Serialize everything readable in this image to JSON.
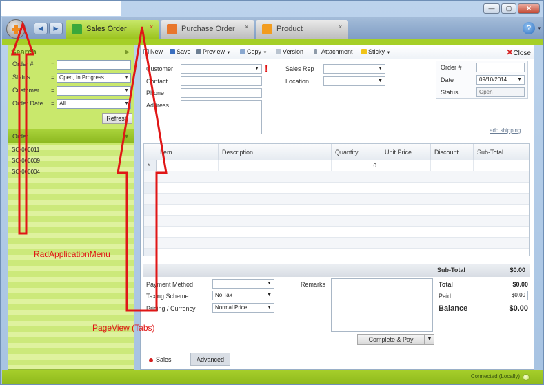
{
  "window": {
    "minimize_glyph": "—",
    "maximize_glyph": "▢",
    "close_glyph": "✕"
  },
  "tabs": [
    {
      "label": "Sales Order",
      "close": "×",
      "icon_color": "#3aa83a"
    },
    {
      "label": "Purchase Order",
      "close": "×",
      "icon_color": "#e8762b"
    },
    {
      "label": "Product",
      "close": "×",
      "icon_color": "#f29c1f"
    }
  ],
  "nav": {
    "back_glyph": "◀",
    "forward_glyph": "▶"
  },
  "help": {
    "glyph": "?",
    "caret": "▾"
  },
  "search": {
    "title": "Search",
    "collapse_glyph": "▶",
    "fields": [
      {
        "label": "Order #",
        "value": ""
      },
      {
        "label": "Status",
        "value": "Open, In Progress"
      },
      {
        "label": "Customer",
        "value": ""
      },
      {
        "label": "Order Date",
        "value": "All"
      }
    ],
    "refresh_label": "Refresh"
  },
  "orders": {
    "header": "Order",
    "sort_glyph": "▼",
    "items": [
      "SO-000011",
      "SO-000009",
      "SO-000004"
    ]
  },
  "toolbar": {
    "new": "New",
    "save": "Save",
    "preview": "Preview",
    "copy": "Copy",
    "version": "Version",
    "attachment": "Attachment",
    "sticky": "Sticky",
    "close": "Close"
  },
  "form": {
    "customer_label": "Customer",
    "contact_label": "Contact",
    "phone_label": "Phone",
    "address_label": "Address",
    "salesrep_label": "Sales Rep",
    "location_label": "Location",
    "required_mark": "!",
    "order_no_label": "Order #",
    "date_label": "Date",
    "date_value": "09/10/2014",
    "status_label": "Status",
    "status_value": "Open",
    "add_shipping": "add shipping"
  },
  "grid": {
    "columns": [
      "Item",
      "Description",
      "Quantity",
      "Unit Price",
      "Discount",
      "Sub-Total"
    ],
    "first_row_quantity": "0",
    "row_marker": "*"
  },
  "totals": {
    "subtotal_label": "Sub-Total",
    "subtotal_value": "$0.00",
    "total_label": "Total",
    "total_value": "$0.00",
    "paid_label": "Paid",
    "paid_value": "$0.00",
    "balance_label": "Balance",
    "balance_value": "$0.00"
  },
  "footer_form": {
    "payment_method_label": "Payment Method",
    "taxing_scheme_label": "Taxing Scheme",
    "taxing_scheme_value": "No Tax",
    "pricing_label": "Pricing / Currency",
    "pricing_value": "Normal Price",
    "remarks_label": "Remarks",
    "complete_pay": "Complete & Pay"
  },
  "bottom_tabs": {
    "sales": "Sales",
    "advanced": "Advanced"
  },
  "status": {
    "text": "Connected (Locally)"
  },
  "annotations": {
    "app_menu": "RadApplicationMenu",
    "page_view": "PageView (Tabs)"
  },
  "colors": {
    "accent_green": "#a5cf27",
    "annotation_red": "#e01616"
  }
}
